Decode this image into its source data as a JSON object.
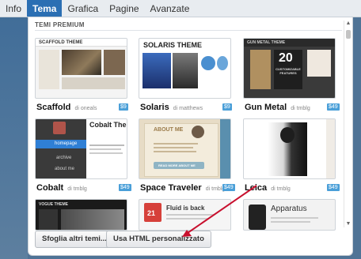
{
  "tabs": [
    {
      "label": "Info"
    },
    {
      "label": "Tema"
    },
    {
      "label": "Grafica"
    },
    {
      "label": "Pagine"
    },
    {
      "label": "Avanzate"
    }
  ],
  "section_title": "TEMI PREMIUM",
  "themes": [
    {
      "name": "Scaffold",
      "author": "di oneals",
      "price": "$9",
      "thumb_text": "SCAFFOLD THEME"
    },
    {
      "name": "Solaris",
      "author": "di matthews",
      "price": "$9",
      "thumb_text": "SOLARIS THEME"
    },
    {
      "name": "Gun Metal",
      "author": "di tmblg",
      "price": "$49",
      "thumb_text": "GUN METAL THEME",
      "thumb_number": "20",
      "thumb_caption": "CUSTOMIZABLE FEATURES"
    },
    {
      "name": "Cobalt",
      "author": "di tmblg",
      "price": "$49",
      "thumb_text": "Cobalt Ther",
      "thumb_menu": [
        "homepage",
        "archive",
        "about me"
      ]
    },
    {
      "name": "Space Traveler",
      "author": "di tmblg",
      "price": "$49",
      "thumb_text": "ABOUT ME",
      "thumb_button": "READ MORE ABOUT ME"
    },
    {
      "name": "Leica",
      "author": "di tmblg",
      "price": "$49",
      "thumb_text": ""
    },
    {
      "name": "",
      "author": "",
      "price": "",
      "thumb_text": "VOGUE THEME"
    },
    {
      "name": "",
      "author": "",
      "price": "",
      "thumb_text": "Fluid is back",
      "thumb_date": "21"
    },
    {
      "name": "",
      "author": "",
      "price": "",
      "thumb_text": "Apparatus"
    }
  ],
  "buttons": {
    "browse": "Sfoglia altri temi...",
    "custom_html": "Usa HTML personalizzato"
  },
  "colors": {
    "active_tab": "#2b6fb3",
    "price_badge": "#4a9fd8",
    "arrow": "#c8102e"
  }
}
